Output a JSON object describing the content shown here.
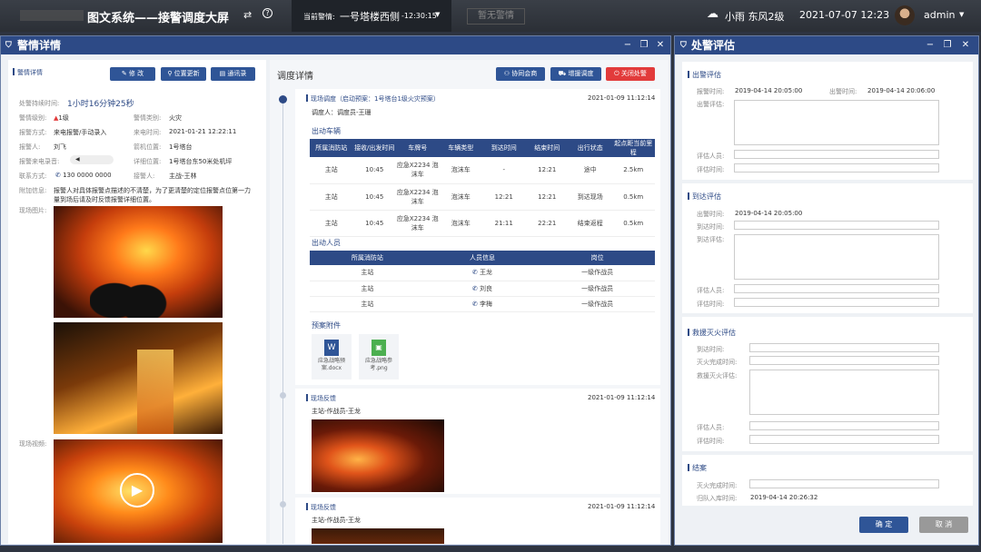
{
  "topbar": {
    "title": "图文系统——接警调度大屏",
    "current_alert_label": "当前警情:",
    "current_alert_value": "一号塔楼西侧",
    "current_alert_time": "-12:30:15",
    "no_alert": "暂无警情",
    "weather": "小雨 东风2级",
    "datetime": "2021-07-07 12:23",
    "user": "admin"
  },
  "left_window": {
    "title": "警情详情"
  },
  "detail": {
    "section_label": "警情详情",
    "buttons": [
      "修 改",
      "位置更新",
      "通讯录"
    ],
    "duration_label": "处警持续时间:",
    "duration_value": "1小时16分钟25秒",
    "level_label": "警情级别:",
    "level_value": "1级",
    "category_label": "警情类别:",
    "category_value": "火灾",
    "method_label": "报警方式:",
    "method_value": "来电报警/手动录入",
    "phone_time_label": "来电时间:",
    "phone_time_value": "2021-01-21 12:22:11",
    "reporter_label": "报警人:",
    "reporter_value": "刘飞",
    "dev_loc_label": "箭机位置:",
    "dev_loc_value": "1号塔台",
    "recording_label": "报警来电录音:",
    "detail_loc_label": "详细位置:",
    "detail_loc_value": "1号塔台东50米处机坪",
    "contact_label": "联系方式:",
    "contact_value": "130 0000 0000",
    "receiver_label": "接警人:",
    "receiver_value": "主战-王林",
    "note_label": "附加信息:",
    "note_value": "报警人对具体报警点描述的不清楚，为了更清楚的定位报警点位第一力量到场后请及时反馈报警详细位置。",
    "photos_label": "现场图片:",
    "video_label": "现场视频:"
  },
  "dispatch": {
    "title": "调度详情",
    "buttons": [
      "协同会商",
      "增援调度",
      "关闭处警"
    ],
    "entry1": {
      "title": "现场调度（启动预案：1号塔台1级火灾预案）",
      "time": "2021-01-09 11:12:14",
      "dispatcher": "调度人：调度员-王珊",
      "vehicle_section": "出动车辆",
      "vehicle_headers": [
        "所属消防站",
        "接收/出发时间",
        "车牌号",
        "车辆类型",
        "到达时间",
        "结束时间",
        "出行状态",
        "起点距当前里程"
      ],
      "vehicle_rows": [
        [
          "主站",
          "10:45",
          "应急X2234 泡沫车",
          "泡沫车",
          "-",
          "12:21",
          "途中",
          "2.5km"
        ],
        [
          "主站",
          "10:45",
          "应急X2234 泡沫车",
          "泡沫车",
          "12:21",
          "12:21",
          "到达现场",
          "0.5km"
        ],
        [
          "主站",
          "10:45",
          "应急X2234 泡沫车",
          "泡沫车",
          "21:11",
          "22:21",
          "结束返程",
          "0.5km"
        ]
      ],
      "personnel_section": "出动人员",
      "personnel_headers": [
        "所属消防站",
        "人员信息",
        "岗位"
      ],
      "personnel_rows": [
        [
          "主站",
          "王龙",
          "一级作战员"
        ],
        [
          "主站",
          "刘良",
          "一级作战员"
        ],
        [
          "主站",
          "李梅",
          "一级作战员"
        ]
      ],
      "attach_section": "预案附件",
      "attachments": [
        "应急战略预案.docx",
        "应急战略参考.png"
      ]
    },
    "entry2": {
      "title": "现场反馈",
      "time": "2021-01-09 11:12:14",
      "person": "主站-作战员-王龙"
    },
    "entry3": {
      "title": "现场反馈",
      "time": "2021-01-09 11:12:14",
      "person": "主站-作战员-王龙"
    }
  },
  "eval": {
    "title": "处警评估",
    "s1": {
      "title": "出警评估",
      "alarm_time_label": "报警时间:",
      "alarm_time": "2019-04-14 20:05:00",
      "dispatch_time_label": "出警时间:",
      "dispatch_time": "2019-04-14 20:06:00",
      "eval_label": "出警评估:",
      "person_label": "评估人员:",
      "time_label": "评估时间:"
    },
    "s2": {
      "title": "到达评估",
      "dispatch_time_label": "出警时间:",
      "dispatch_time": "2019-04-14 20:05:00",
      "arrive_label": "到达时间:",
      "eval_label": "到达评估:",
      "person_label": "评估人员:",
      "time_label": "评估时间:"
    },
    "s3": {
      "title": "救援灭火评估",
      "arrive_label": "到达时间:",
      "done_label": "灭火完成时间:",
      "eval_label": "救援灭火评估:",
      "person_label": "评估人员:",
      "time_label": "评估时间:"
    },
    "s4": {
      "title": "结案",
      "done_label": "灭火完成时间:",
      "return_label": "归队入库时间:",
      "return_time": "2019-04-14 20:26:32"
    },
    "confirm": "确 定",
    "cancel": "取 消"
  },
  "colors": {
    "accent": "#2d4a86",
    "danger": "#e23b3b",
    "button": "#2f5597"
  }
}
